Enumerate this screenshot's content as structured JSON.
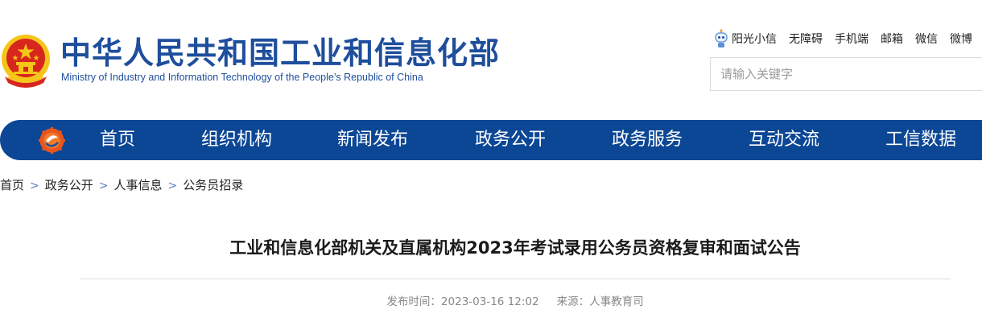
{
  "header": {
    "title_cn": "中华人民共和国工业和信息化部",
    "title_en": "Ministry of Industry and Information Technology of the People’s Republic of China",
    "emblem_icon": "national-emblem-icon",
    "top_links": [
      {
        "label": "阳光小信",
        "icon": "robot-icon"
      },
      {
        "label": "无障碍"
      },
      {
        "label": "手机端"
      },
      {
        "label": "邮箱"
      },
      {
        "label": "微信"
      },
      {
        "label": "微博"
      }
    ],
    "search": {
      "placeholder": "请输入关键字"
    }
  },
  "nav": {
    "logo_icon": "miit-logo-icon",
    "items": [
      {
        "label": "首页"
      },
      {
        "label": "组织机构"
      },
      {
        "label": "新闻发布"
      },
      {
        "label": "政务公开"
      },
      {
        "label": "政务服务"
      },
      {
        "label": "互动交流"
      },
      {
        "label": "工信数据"
      }
    ]
  },
  "breadcrumb": {
    "separator": ">",
    "items": [
      "首页",
      "政务公开",
      "人事信息",
      "公务员招录"
    ]
  },
  "article": {
    "title": "工业和信息化部机关及直属机构2023年考试录用公务员资格复审和面试公告",
    "publish_label": "发布时间：",
    "publish_time": "2023-03-16 12:02",
    "source_label": "来源：",
    "source": "人事教育司"
  },
  "colors": {
    "brand_blue": "#1e4e9c",
    "nav_blue": "#0c4796",
    "emblem_red": "#d7261e",
    "emblem_gold": "#f5c518"
  }
}
